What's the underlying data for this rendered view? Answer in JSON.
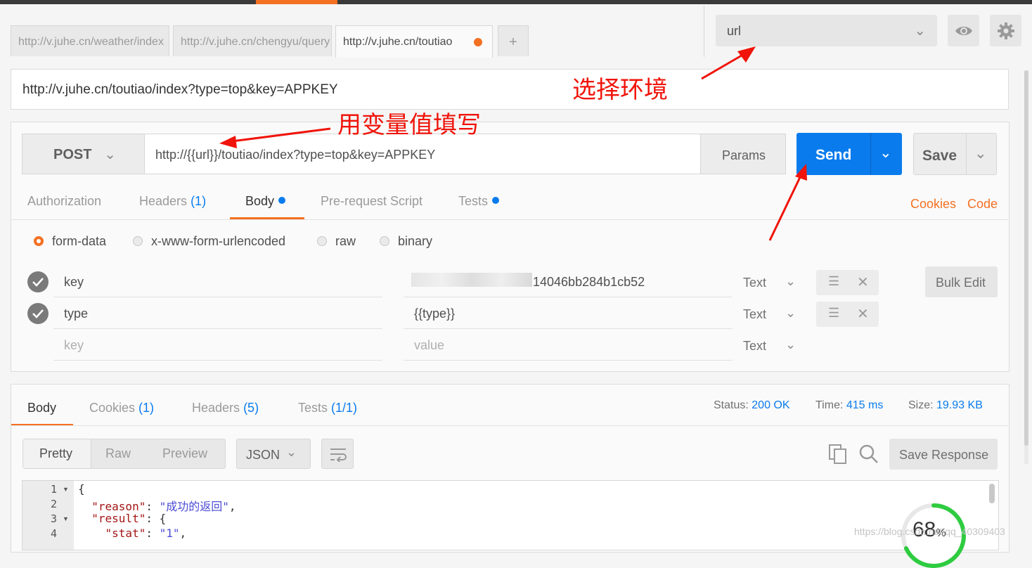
{
  "tabs": [
    {
      "label": "http://v.juhe.cn/weather/index"
    },
    {
      "label": "http://v.juhe.cn/chengyu/query"
    },
    {
      "label": "http://v.juhe.cn/toutiao"
    },
    {
      "label": "+"
    }
  ],
  "environment": {
    "selected": "url"
  },
  "url_display": "http://v.juhe.cn/toutiao/index?type=top&key=APPKEY",
  "request": {
    "method": "POST",
    "url": "http://{{url}}/toutiao/index?type=top&key=APPKEY",
    "params_label": "Params",
    "send_label": "Send",
    "save_label": "Save"
  },
  "request_tabs": {
    "authorization": "Authorization",
    "headers": "Headers",
    "headers_count": "(1)",
    "body": "Body",
    "prerequest": "Pre-request Script",
    "tests": "Tests",
    "cookies_link": "Cookies",
    "code_link": "Code"
  },
  "body_modes": [
    "form-data",
    "x-www-form-urlencoded",
    "raw",
    "binary"
  ],
  "form_rows": [
    {
      "key": "key",
      "value": "14046bb284b1cb52",
      "type": "Text"
    },
    {
      "key": "type",
      "value": "{{type}}",
      "type": "Text"
    }
  ],
  "new_row": {
    "key_placeholder": "key",
    "value_placeholder": "value",
    "type": "Text"
  },
  "bulk_edit_label": "Bulk Edit",
  "response": {
    "tabs": {
      "body": "Body",
      "cookies": "Cookies",
      "cookies_count": "(1)",
      "headers": "Headers",
      "headers_count": "(5)",
      "tests": "Tests",
      "tests_count": "(1/1)"
    },
    "status_label": "Status:",
    "status": "200 OK",
    "time_label": "Time:",
    "time": "415 ms",
    "size_label": "Size:",
    "size": "19.93 KB",
    "views": [
      "Pretty",
      "Raw",
      "Preview"
    ],
    "format": "JSON",
    "save_response_label": "Save Response",
    "code_lines": [
      "1",
      "2",
      "3",
      "4"
    ],
    "json": {
      "open": "{",
      "reason_key": "\"reason\"",
      "reason_val": "\"成功的返回\"",
      "result_key": "\"result\"",
      "result_open": ": {",
      "stat_key": "\"stat\"",
      "stat_val": "\"1\""
    }
  },
  "progress": {
    "value": 68,
    "text": "68",
    "unit": "%"
  },
  "watermark": "https://blog.csdn.net/qq_40309403",
  "annotations": {
    "select_env": "选择环境",
    "fill_variable": "用变量值填写"
  },
  "colors": {
    "accent": "#f47023",
    "send": "#097bed",
    "annotation": "#f0140a",
    "progress": "#2ecc40"
  }
}
